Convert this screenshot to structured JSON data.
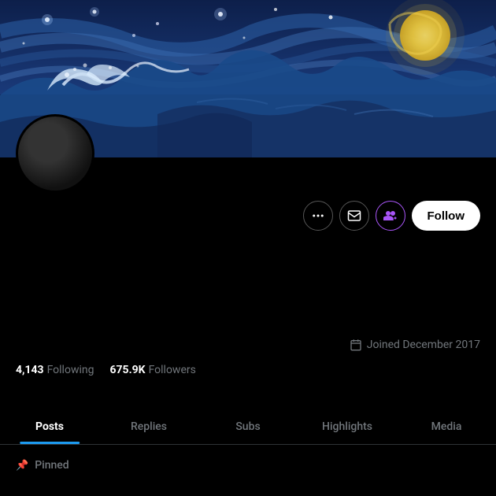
{
  "banner": {
    "alt": "Artistic banner combining The Great Wave and Starry Night"
  },
  "avatar": {
    "alt": "User profile avatar"
  },
  "actions": {
    "more_label": "···",
    "mail_icon": "mail",
    "person_icon": "person-plus",
    "follow_label": "Follow"
  },
  "joined": {
    "icon": "calendar",
    "text": "Joined December 2017"
  },
  "stats": [
    {
      "value": "4,143",
      "label": "Following"
    },
    {
      "value": "675.9K",
      "label": "Followers"
    }
  ],
  "tabs": [
    {
      "id": "posts",
      "label": "Posts",
      "active": true
    },
    {
      "id": "replies",
      "label": "Replies",
      "active": false
    },
    {
      "id": "subs",
      "label": "Subs",
      "active": false
    },
    {
      "id": "highlights",
      "label": "Highlights",
      "active": false
    },
    {
      "id": "media",
      "label": "Media",
      "active": false
    }
  ],
  "pinned": {
    "icon": "📌",
    "label": "Pinned"
  }
}
